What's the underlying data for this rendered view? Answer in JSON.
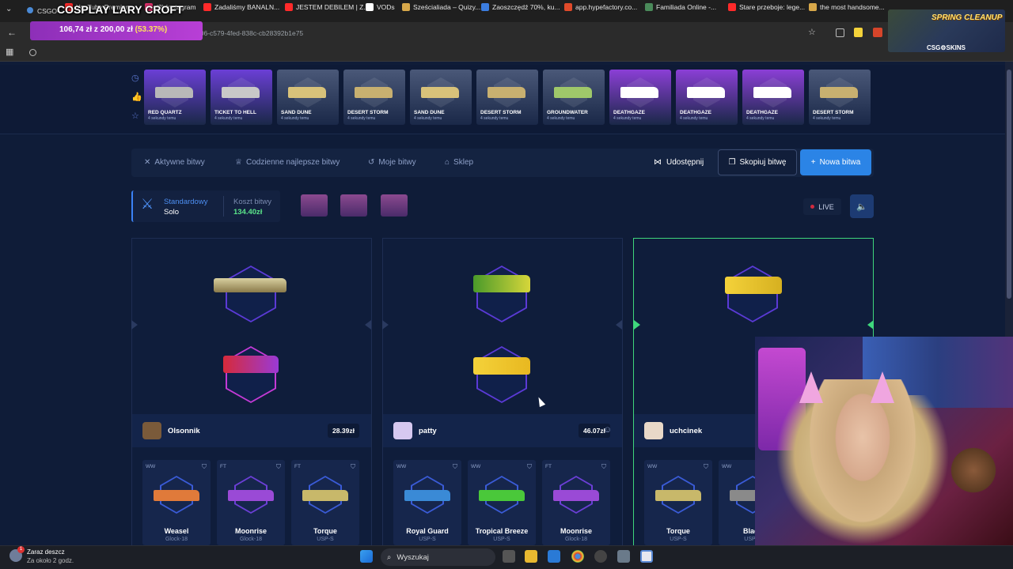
{
  "browser": {
    "tab_title": "CSGO-",
    "url": "...6480106-c579-4fed-838c-cb28392b1e75",
    "bookmarks": [
      {
        "label": "YouTube Premium -...",
        "color": "#ff2a2a"
      },
      {
        "label": "(2) Instagram",
        "color": "#e1306c"
      },
      {
        "label": "Zadaliśmy BANALN...",
        "color": "#ff2a2a"
      },
      {
        "label": "JESTEM DEBILEM | Z...",
        "color": "#ff2a2a"
      },
      {
        "label": "VODs",
        "color": "#ffffff"
      },
      {
        "label": "Sześcialiada – Quizy...",
        "color": "#d8a84a"
      },
      {
        "label": "Zaoszczędź 70%, ku...",
        "color": "#3b7de0"
      },
      {
        "label": "app.hypefactory.co...",
        "color": "#e04a2a"
      },
      {
        "label": "Familiada Online -...",
        "color": "#4a8a5a"
      },
      {
        "label": "Stare przeboje: lege...",
        "color": "#ff2a2a"
      },
      {
        "label": "the most handsome...",
        "color": "#d8a84a"
      }
    ]
  },
  "stream": {
    "title": "COSPLAY LARY CROFT",
    "progress_text": "106,74 zł z 200,00 zł",
    "progress_pct": "(53.37%)",
    "overlay_title": "SPRING CLEANUP",
    "overlay_brand": "CSG⚙SKINS"
  },
  "drops": {
    "time_label": "4 sekundy temu",
    "items": [
      {
        "name": "RED QUARTZ",
        "color": "#6b3fd6",
        "gun": "#b8b8b8"
      },
      {
        "name": "TICKET TO HELL",
        "color": "#6b3fd6",
        "gun": "#c8c8c8"
      },
      {
        "name": "SAND DUNE",
        "color": "#4a5878",
        "gun": "#d8c27a"
      },
      {
        "name": "DESERT STORM",
        "color": "#4a5878",
        "gun": "#c8b070"
      },
      {
        "name": "SAND DUNE",
        "color": "#4a5878",
        "gun": "#d8c27a"
      },
      {
        "name": "DESERT STORM",
        "color": "#4a5878",
        "gun": "#c8b070"
      },
      {
        "name": "GROUNDWATER",
        "color": "#4a5878",
        "gun": "#9fc86a"
      },
      {
        "name": "DEATHGAZE",
        "color": "#8b3fd6",
        "gun": "#ffffff"
      },
      {
        "name": "DEATHGAZE",
        "color": "#8b3fd6",
        "gun": "#ffffff"
      },
      {
        "name": "DEATHGAZE",
        "color": "#8b3fd6",
        "gun": "#ffffff"
      },
      {
        "name": "DESERT STORM",
        "color": "#4a5878",
        "gun": "#c8b070"
      }
    ]
  },
  "nav": {
    "active": "Aktywne bitwy",
    "daily": "Codzienne najlepsze bitwy",
    "mine": "Moje bitwy",
    "shop": "Sklep",
    "share": "Udostępnij",
    "copy": "Skopiuj bitwę",
    "new": "Nowa bitwa"
  },
  "battle": {
    "mode_label": "Standardowy",
    "mode_sub": "Solo",
    "cost_label": "Koszt bitwy",
    "cost_value": "134.40zł",
    "live": "LIVE"
  },
  "players": [
    {
      "name": "Olsonnik",
      "value": "28.39zł",
      "avatar": "#7a5a3a",
      "cards": [
        {
          "cond": "WW",
          "name": "Weasel",
          "weapon": "Glock-18",
          "hex": "#3a5bd6",
          "gun": "#e07a3a"
        },
        {
          "cond": "FT",
          "name": "Moonrise",
          "weapon": "Glock-18",
          "hex": "#6b3fd6",
          "gun": "#9a4ad6"
        },
        {
          "cond": "FT",
          "name": "Torque",
          "weapon": "USP-S",
          "hex": "#3a5bd6",
          "gun": "#c8b86a"
        }
      ]
    },
    {
      "name": "patty",
      "value": "46.07zł",
      "avatar": "#d6c8f0",
      "cards": [
        {
          "cond": "WW",
          "name": "Royal Guard",
          "weapon": "USP-S",
          "hex": "#3a5bd6",
          "gun": "#3a8ad6"
        },
        {
          "cond": "WW",
          "name": "Tropical Breeze",
          "weapon": "USP-S",
          "hex": "#3a5bd6",
          "gun": "#4ac83a"
        },
        {
          "cond": "FT",
          "name": "Moonrise",
          "weapon": "Glock-18",
          "hex": "#6b3fd6",
          "gun": "#9a4ad6"
        }
      ]
    },
    {
      "name": "uchcinek",
      "value": "",
      "avatar": "#e8d8c8",
      "cards": [
        {
          "cond": "WW",
          "name": "Torque",
          "weapon": "USP-S",
          "hex": "#3a5bd6",
          "gun": "#c8b86a"
        },
        {
          "cond": "WW",
          "name": "Black",
          "weapon": "USP-S",
          "hex": "#3a5bd6",
          "gun": "#8a8a8a"
        }
      ]
    }
  ],
  "taskbar": {
    "weather_title": "Zaraz deszcz",
    "weather_sub": "Za około 2 godz.",
    "weather_badge": "1",
    "search": "Wyszukaj"
  }
}
